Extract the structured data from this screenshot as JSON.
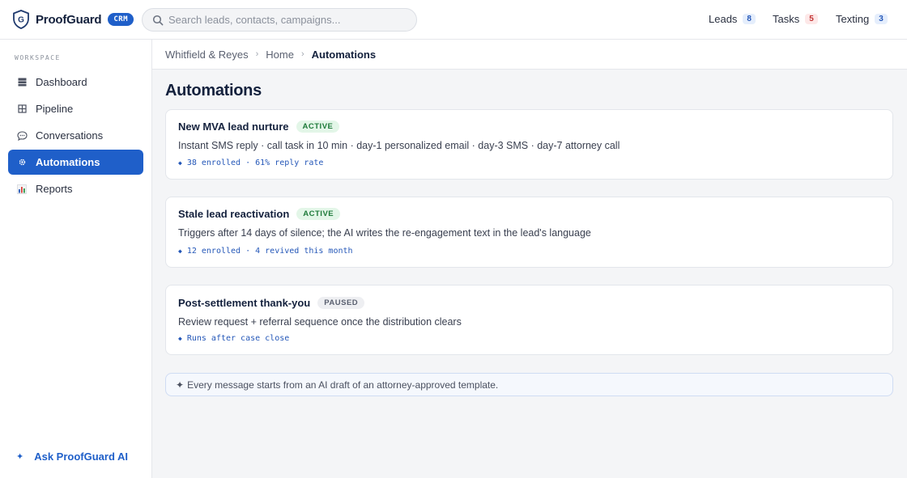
{
  "app": {
    "brand": "ProofGuard",
    "badge": "CRM"
  },
  "search": {
    "placeholder": "Search leads, contacts, campaigns..."
  },
  "topnav": [
    {
      "label": "Leads",
      "count": "8"
    },
    {
      "label": "Tasks",
      "count": "5"
    },
    {
      "label": "Texting",
      "count": "3"
    }
  ],
  "sidebar": {
    "section": "WORKSPACE",
    "items": [
      {
        "label": "Dashboard",
        "icon": "dashboard-icon"
      },
      {
        "label": "Pipeline",
        "icon": "pipeline-icon"
      },
      {
        "label": "Conversations",
        "icon": "chat-icon"
      },
      {
        "label": "Automations",
        "icon": "gear-icon",
        "active": true
      },
      {
        "label": "Reports",
        "icon": "chart-icon"
      }
    ],
    "ask_ai": "Ask ProofGuard AI"
  },
  "breadcrumb": [
    "Whitfield & Reyes",
    "Home",
    "Automations"
  ],
  "page": {
    "title": "Automations"
  },
  "automations": [
    {
      "name": "New MVA lead nurture",
      "status": "ACTIVE",
      "description": "Instant SMS reply · call task in 10 min · day-1 personalized email · day-3 SMS · day-7 attorney call",
      "meta": "38 enrolled · 61% reply rate"
    },
    {
      "name": "Stale lead reactivation",
      "status": "ACTIVE",
      "description": "Triggers after 14 days of silence; the AI writes the re-engagement text in the lead's language",
      "meta": "12 enrolled · 4 revived this month"
    },
    {
      "name": "Post-settlement thank-you",
      "status": "PAUSED",
      "description": "Review request + referral sequence once the distribution clears",
      "meta": "Runs after case close"
    }
  ],
  "note": "Every message starts from an AI draft of an attorney-approved template.",
  "colors": {
    "accent": "#1f5fc9",
    "active_badge": "#1e7a3a",
    "paused_badge": "#5a6070"
  }
}
